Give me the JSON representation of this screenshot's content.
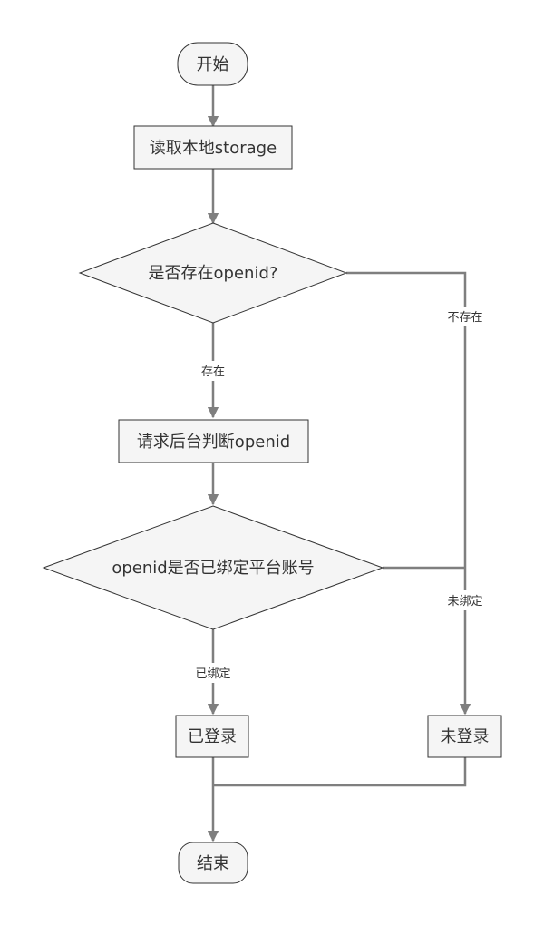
{
  "nodes": {
    "start": "开始",
    "read_storage": "读取本地storage",
    "check_openid": "是否存在openid?",
    "request_backend": "请求后台判断openid",
    "check_bound": "openid是否已绑定平台账号",
    "logged_in": "已登录",
    "not_logged_in": "未登录",
    "end": "结束"
  },
  "edges": {
    "exists": "存在",
    "not_exists": "不存在",
    "bound": "已绑定",
    "not_bound": "未绑定"
  },
  "colors": {
    "node_fill": "#f5f5f5",
    "node_stroke": "#333333",
    "edge": "#7f7f7f",
    "text": "#333333"
  }
}
